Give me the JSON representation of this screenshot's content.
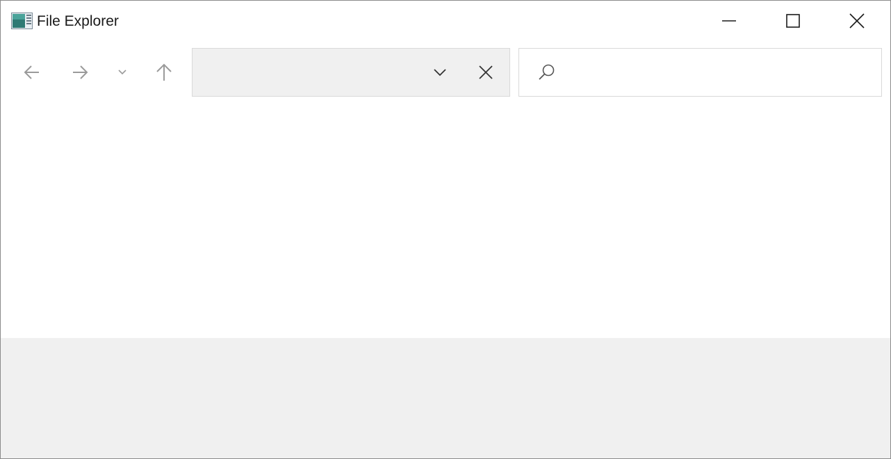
{
  "window": {
    "title": "File Explorer",
    "app_icon": "file-explorer-app-icon"
  },
  "caption_buttons": {
    "minimize_icon": "minimize-icon",
    "maximize_icon": "maximize-icon",
    "close_icon": "close-icon"
  },
  "navigation": {
    "back_icon": "arrow-left-icon",
    "forward_icon": "arrow-right-icon",
    "recent_icon": "chevron-down-icon",
    "up_icon": "arrow-up-icon"
  },
  "address_bar": {
    "value": "",
    "dropdown_icon": "chevron-down-icon",
    "clear_icon": "close-icon"
  },
  "search": {
    "value": "",
    "placeholder": "",
    "icon": "search-icon"
  },
  "colors": {
    "window_bg": "#ffffff",
    "address_bg": "#f0f0f0",
    "footer_bg": "#f0f0f0",
    "icon_disabled": "#9a9a9a",
    "icon_default": "#333333"
  }
}
